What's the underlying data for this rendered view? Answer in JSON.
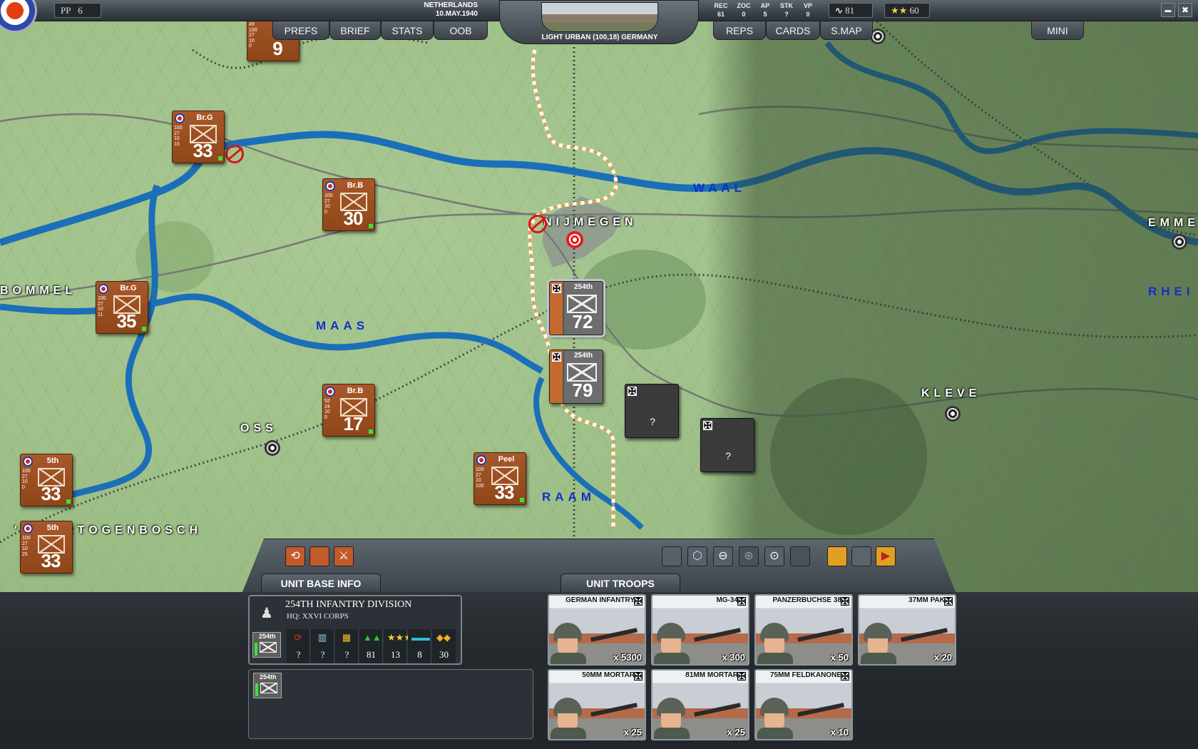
{
  "top_bar": {
    "pp_label": "PP",
    "pp_value": "6",
    "country": "NETHERLANDS",
    "date": "10.MAY.1940",
    "terrain": "LIGHT URBAN (100,18) GERMANY",
    "stats": [
      {
        "label": "REC",
        "value": "61"
      },
      {
        "label": "ZOC",
        "value": "0"
      },
      {
        "label": "AP",
        "value": "5"
      },
      {
        "label": "STK",
        "value": "?"
      },
      {
        "label": "VP",
        "value": "0"
      }
    ],
    "supply": "81",
    "stars": "60",
    "minimize": "▬",
    "close": "✖"
  },
  "tabs_left": [
    "PREFS",
    "BRIEF",
    "STATS",
    "OOB"
  ],
  "tabs_right": [
    "REPS",
    "CARDS",
    "S.MAP"
  ],
  "tab_mini": "MINI",
  "map": {
    "rivers": [
      "WAAL",
      "MAAS",
      "RAAM",
      "RHEI"
    ],
    "cities": [
      "NIJMEGEN",
      "OSS",
      "KLEVE",
      "EMME",
      "BOMMEL",
      "'S HERTOGENBOSCH"
    ],
    "allied_units": [
      {
        "name": "",
        "strength": "9",
        "stats": [
          "49",
          "100",
          "27",
          "10",
          "0"
        ]
      },
      {
        "name": "Br.G",
        "strength": "33",
        "stats": [
          "100",
          "27",
          "10",
          "10"
        ]
      },
      {
        "name": "Br.B",
        "strength": "30",
        "stats": [
          "100",
          "27",
          "10",
          "0"
        ]
      },
      {
        "name": "Br.G",
        "strength": "35",
        "stats": [
          "100",
          "27",
          "10",
          "11"
        ]
      },
      {
        "name": "Br.B",
        "strength": "17",
        "stats": [
          "52",
          "24",
          "10",
          "0"
        ]
      },
      {
        "name": "Peel",
        "strength": "33",
        "stats": [
          "100",
          "27",
          "10",
          "100"
        ]
      },
      {
        "name": "5th",
        "strength": "33",
        "stats": [
          "100",
          "27",
          "10",
          "0"
        ]
      },
      {
        "name": "5th",
        "strength": "33",
        "stats": [
          "100",
          "27",
          "10",
          "25"
        ]
      }
    ],
    "german_units": [
      {
        "name": "254th",
        "strength": "72"
      },
      {
        "name": "254th",
        "strength": "79"
      }
    ],
    "unknown_label": "?"
  },
  "hud": {
    "tab_unit_base_info": "UNIT BASE INFO",
    "tab_unit_troops": "UNIT TROOPS",
    "unit": {
      "name": "254TH INFANTRY DIVISION",
      "hq": "HQ: XXVI CORPS",
      "badge": "254th",
      "stats": [
        "?",
        "?",
        "?",
        "81",
        "13",
        "8",
        "30"
      ]
    },
    "selected_badge": "254th",
    "troops": [
      {
        "name": "GERMAN INFANTRY",
        "count": "x 5300"
      },
      {
        "name": "MG-34",
        "count": "x 300"
      },
      {
        "name": "PANZERBUCHSE 38",
        "count": "x 50"
      },
      {
        "name": "37MM PAK",
        "count": "x 20"
      },
      {
        "name": "50MM MORTAR",
        "count": "x 25"
      },
      {
        "name": "81MM MORTAR",
        "count": "x 25"
      },
      {
        "name": "75MM FELDKANONE",
        "count": "x 10"
      }
    ]
  }
}
